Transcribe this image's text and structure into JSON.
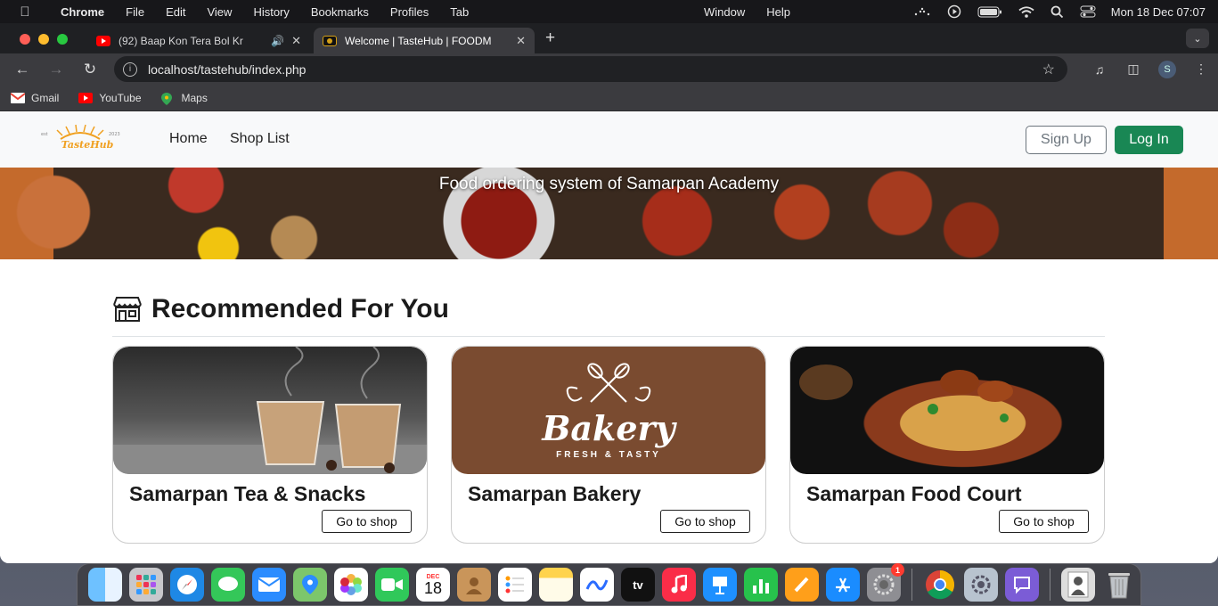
{
  "menubar": {
    "app": "Chrome",
    "items": [
      "File",
      "Edit",
      "View",
      "History",
      "Bookmarks",
      "Profiles",
      "Tab"
    ],
    "right_items": [
      "Window",
      "Help"
    ],
    "clock": "Mon 18 Dec  07:07"
  },
  "tabs": [
    {
      "title": "(92) Baap Kon Tera Bol Kr",
      "favicon": "youtube-icon",
      "audible": true
    },
    {
      "title": "Welcome | TasteHub | FOODM",
      "favicon": "tastehub-icon",
      "active": true
    }
  ],
  "toolbar": {
    "url": "localhost/tastehub/index.php",
    "profile_initial": "S"
  },
  "bookmarks": [
    {
      "label": "Gmail",
      "icon": "gmail-icon"
    },
    {
      "label": "YouTube",
      "icon": "youtube-icon"
    },
    {
      "label": "Maps",
      "icon": "maps-icon"
    }
  ],
  "site": {
    "logo_text": "TasteHub",
    "nav": {
      "home": "Home",
      "shop_list": "Shop List"
    },
    "signup": "Sign Up",
    "login": "Log In",
    "hero_text": "Food ordering system of Samarpan Academy",
    "section_title": "Recommended For You",
    "shops": [
      {
        "name": "Samarpan Tea & Snacks",
        "button": "Go to shop",
        "image": "tea-image"
      },
      {
        "name": "Samarpan Bakery",
        "button": "Go to shop",
        "image": "bakery-image",
        "image_text": "Bakery",
        "image_subtext": "FRESH & TASTY"
      },
      {
        "name": "Samarpan Food Court",
        "button": "Go to shop",
        "image": "food-image"
      }
    ]
  },
  "dock": {
    "calendar_month": "DEC",
    "calendar_day": "18",
    "appletv_label": "tv",
    "settings_badge": "1"
  },
  "colors": {
    "login_green": "#198754",
    "chrome_dark": "#3b3b3f",
    "bakery_brown": "#7a4b30"
  }
}
